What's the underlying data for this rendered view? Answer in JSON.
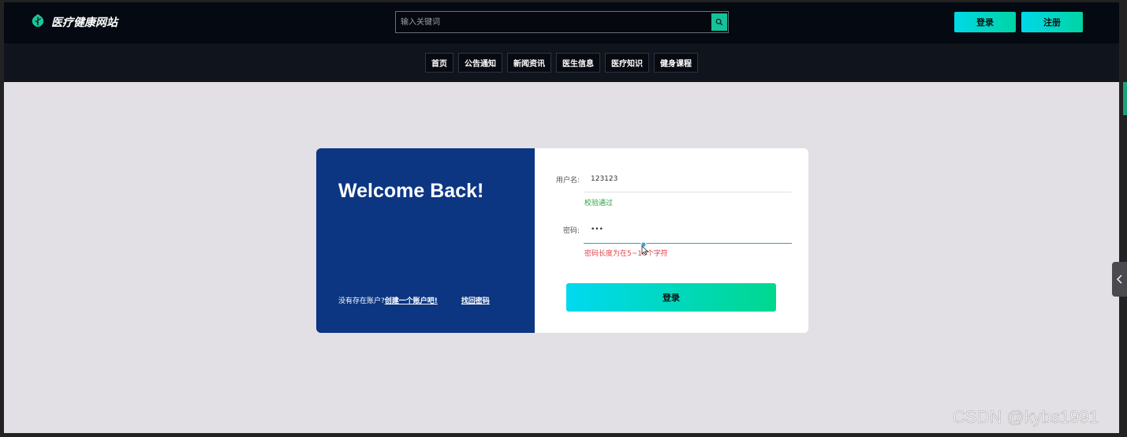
{
  "header": {
    "site_title": "医疗健康网站",
    "search_placeholder": "输入关键词",
    "login_label": "登录",
    "register_label": "注册"
  },
  "nav": {
    "items": [
      "首页",
      "公告通知",
      "新闻资讯",
      "医生信息",
      "医疗知识",
      "健身课程"
    ]
  },
  "login_card": {
    "welcome": "Welcome Back!",
    "no_account": "没有存在账户?",
    "create_account": "创建一个账户吧!",
    "forgot_password": "找回密码",
    "username_label": "用户名:",
    "username_value": "123123",
    "username_hint": "校验通过",
    "password_label": "密码:",
    "password_value": "•••",
    "password_hint": "密码长度为在5~16个字符",
    "submit_label": "登录"
  },
  "watermark": "CSDN @kybs1991",
  "colors": {
    "accent": "#12c39b",
    "card_left": "#0c3682",
    "error": "#e0454a",
    "success": "#2f9e44"
  }
}
